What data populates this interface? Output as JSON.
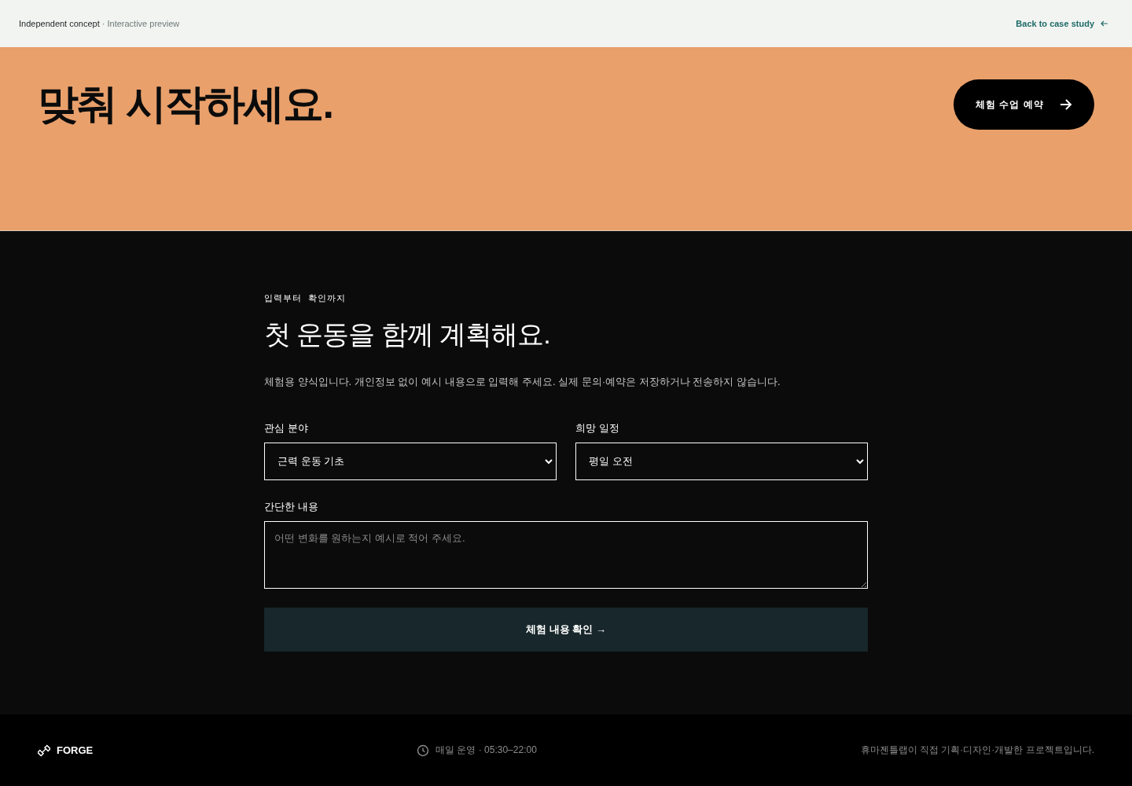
{
  "header": {
    "brand": "Independent concept",
    "subtitle": "· Interactive preview",
    "back_link": "Back to case study"
  },
  "hero": {
    "heading": "맞춰 시작하세요.",
    "button": "체험 수업 예약"
  },
  "form": {
    "eyebrow": "입력부터  확인까지",
    "title": "첫 운동을 함께 계획해요.",
    "description": "체험용 양식입니다. 개인정보 없이 예시 내용으로 입력해 주세요. 실제 문의·예약은 저장하거나 전송하지 않습니다.",
    "fields": [
      {
        "label": "관심 분야",
        "value": "근력 운동 기초"
      },
      {
        "label": "희망 일정",
        "value": "평일 오전"
      }
    ],
    "message": {
      "label": "간단한 내용",
      "placeholder": "어떤 변화를 원하는지 예시로 적어 주세요."
    },
    "submit": "체험 내용 확인 →"
  },
  "footer": {
    "brand": "FORGE",
    "hours": "매일 운영 · 05:30–22:00",
    "credit": "휴마젠틀랩이 직접 기획·디자인·개발한 프로젝트입니다."
  }
}
